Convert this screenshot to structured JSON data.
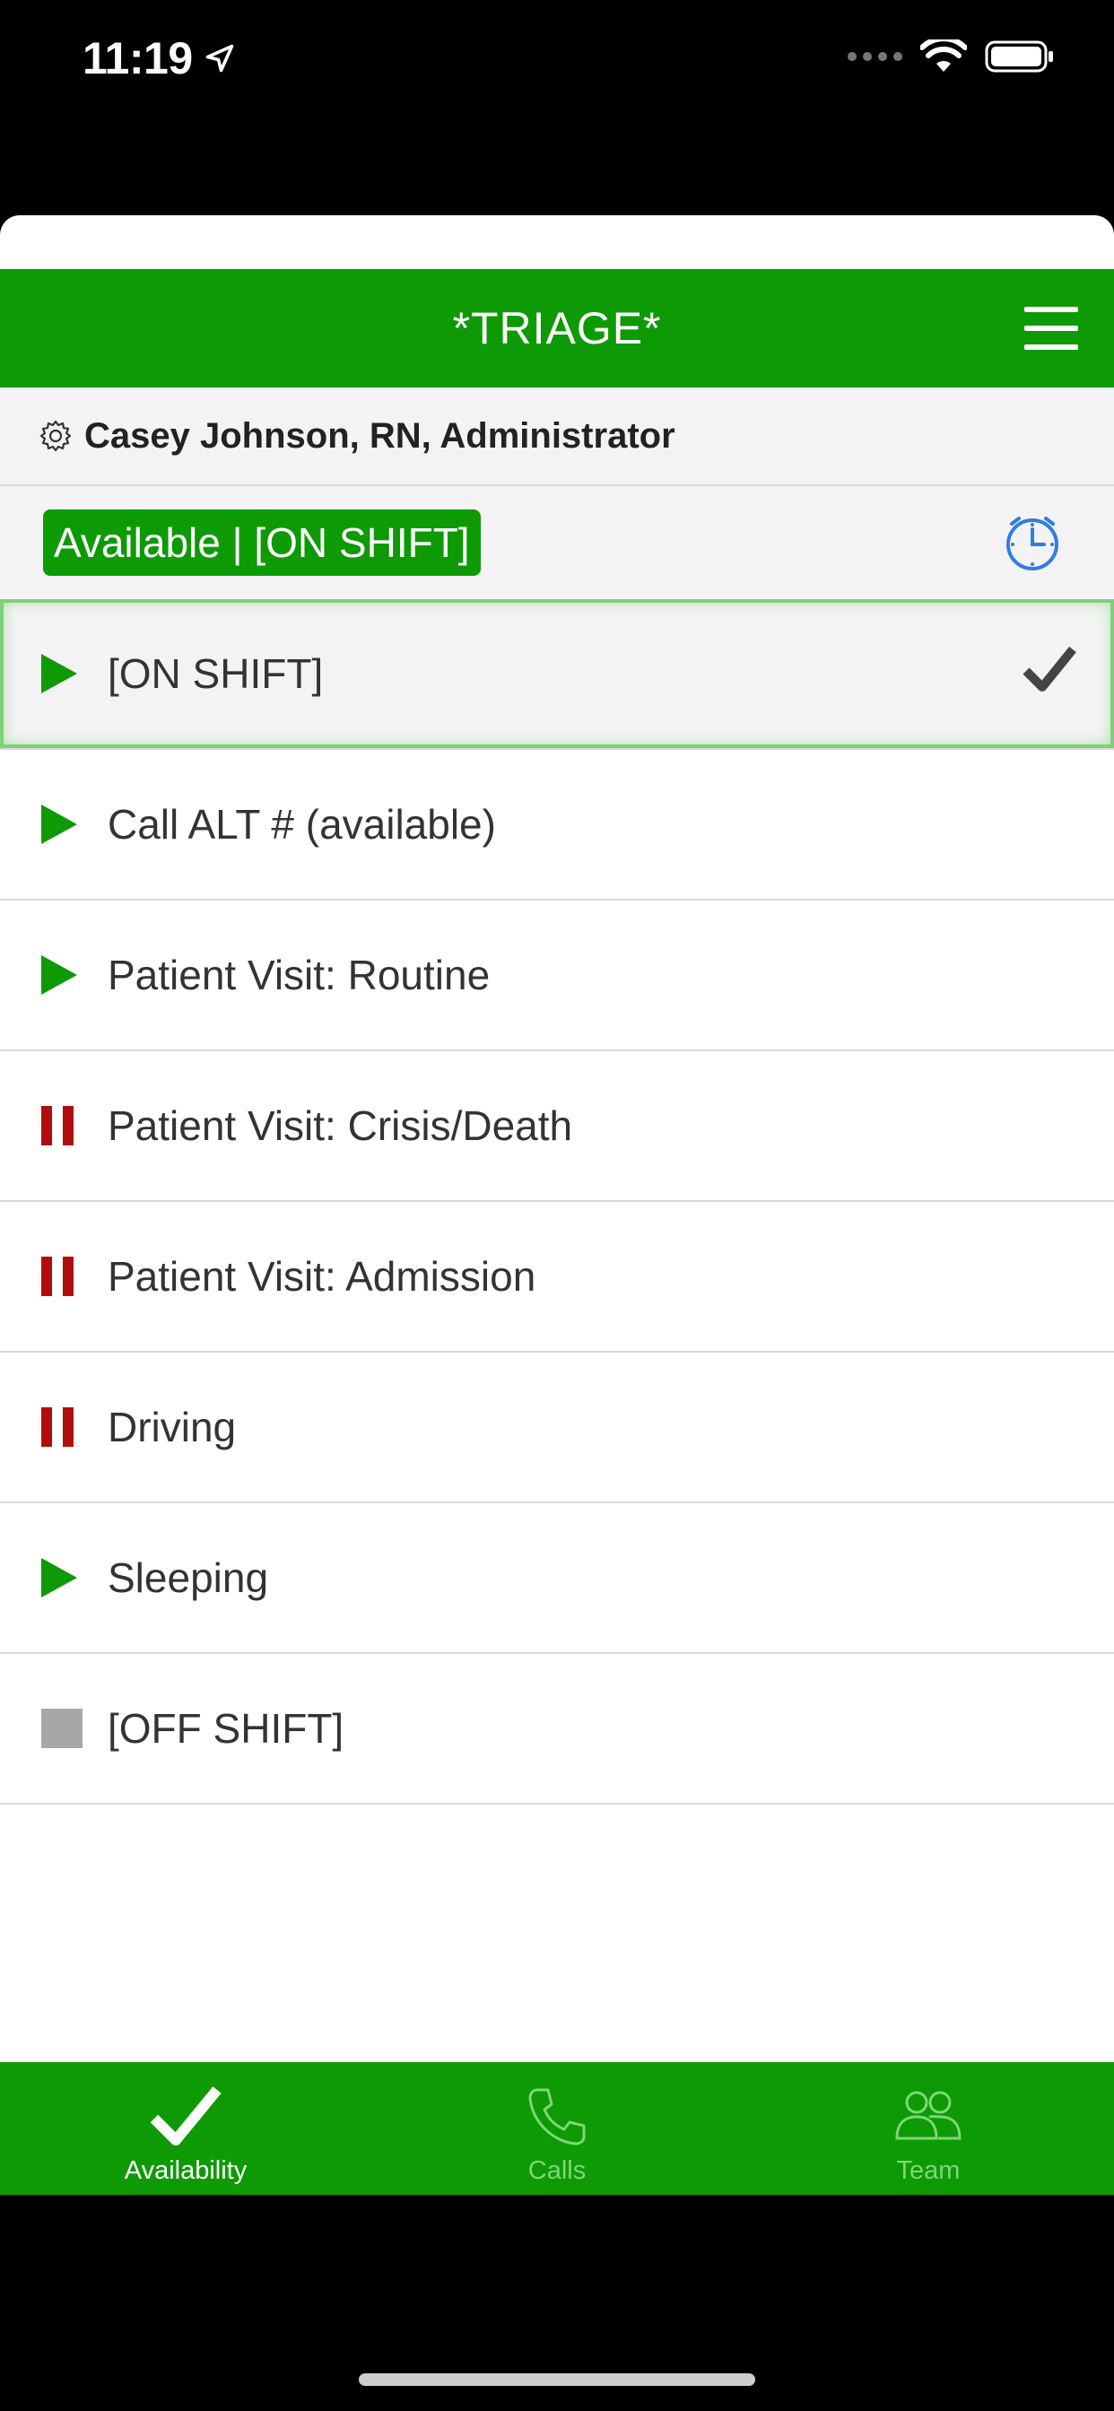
{
  "status_bar": {
    "time": "11:19"
  },
  "header": {
    "title": "*TRIAGE*"
  },
  "user": {
    "name": "Casey Johnson, RN, Administrator"
  },
  "current_status": {
    "label": "Available | [ON SHIFT]"
  },
  "availability_items": [
    {
      "label": "[ON SHIFT]",
      "icon": "play-icon",
      "color": "#0e9a05",
      "selected": true
    },
    {
      "label": "Call ALT # (available)",
      "icon": "play-icon",
      "color": "#0e9a05"
    },
    {
      "label": "Patient Visit: Routine",
      "icon": "play-icon",
      "color": "#0e9a05"
    },
    {
      "label": "Patient Visit: Crisis/Death",
      "icon": "pause-icon",
      "color": "#b20d0d"
    },
    {
      "label": "Patient Visit: Admission",
      "icon": "pause-icon",
      "color": "#b20d0d"
    },
    {
      "label": "Driving",
      "icon": "pause-icon",
      "color": "#b20d0d"
    },
    {
      "label": "Sleeping",
      "icon": "play-icon",
      "color": "#0e9a05"
    },
    {
      "label": "[OFF SHIFT]",
      "icon": "stop-icon",
      "color": "#a7a7a7"
    }
  ],
  "tabs": [
    {
      "label": "Availability",
      "icon": "checkmark-icon",
      "active": true
    },
    {
      "label": "Calls",
      "icon": "phone-icon"
    },
    {
      "label": "Team",
      "icon": "team-icon"
    }
  ],
  "colors": {
    "brand_green": "#0e9a05",
    "paused_red": "#b20d0d",
    "clock_blue": "#2f7de1"
  }
}
